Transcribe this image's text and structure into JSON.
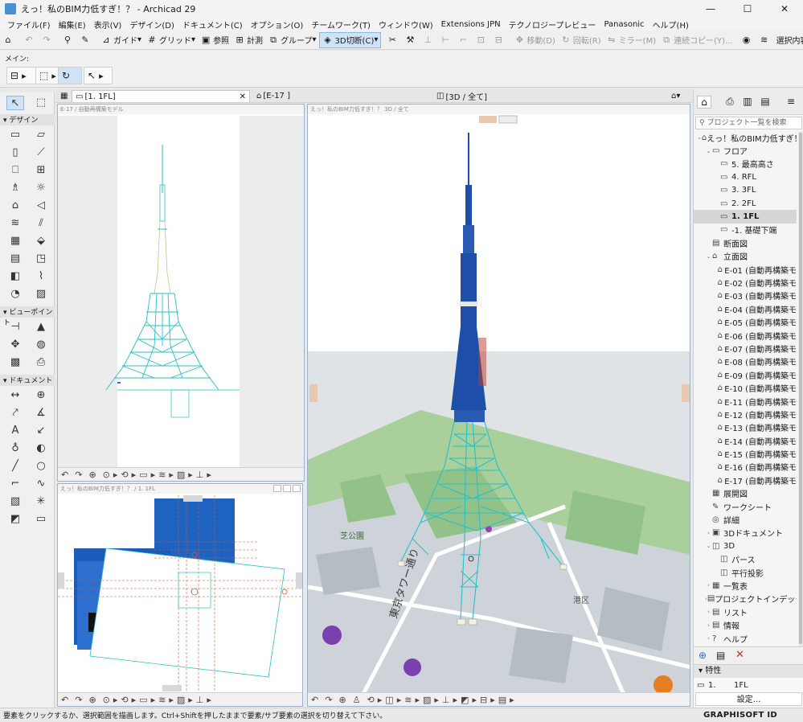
{
  "window": {
    "title": "えっ！私のBIM力低すぎ！？ - Archicad 29",
    "controls": [
      "—",
      "☐",
      "✕"
    ]
  },
  "menu": [
    "ファイル(F)",
    "編集(E)",
    "表示(V)",
    "デザイン(D)",
    "ドキュメント(C)",
    "オプション(O)",
    "チームワーク(T)",
    "ウィンドウ(W)",
    "Extensions JPN",
    "テクノロジープレビュー",
    "Panasonic",
    "ヘルプ(H)"
  ],
  "toolbar": {
    "guide": "ガイド",
    "grid": "グリッド",
    "reference": "参照",
    "measure": "計測",
    "group": "グループ",
    "cut3d": "3D切断(C)",
    "move": "移動(D)",
    "rotate": "回転(R)",
    "mirror": "ミラー(M)",
    "copy": "連続コピー(Y)...",
    "selection": "選択内容のレ"
  },
  "infobox": {
    "label": "メイン:"
  },
  "toolbox": {
    "design": "デザイン",
    "viewpoint": "ビューポイント",
    "document": "ドキュメント"
  },
  "tabs": {
    "floor": "[1. 1FL]",
    "elev": "[E-17 ]",
    "view3d": "[3D / 全て]"
  },
  "panes": {
    "top_title": "E-17 / 自動再構築モデル",
    "bottom_title": "えっ！私のBIM力低すぎ！？ / 1. 1FL",
    "view3d_title": "えっ！私のBIM力低すぎ！？ 3D / 全て"
  },
  "map": {
    "road": "東京タワー通り",
    "park": "芝公園",
    "area": "港区"
  },
  "navigator": {
    "search_placeholder": "プロジェクト一覧を検索",
    "tree": [
      {
        "label": "えっ！私のBIM力低すぎ！",
        "level": 0,
        "icon": "⌂",
        "tw": "⌄"
      },
      {
        "label": "フロア",
        "level": 1,
        "icon": "▭",
        "tw": "⌄"
      },
      {
        "label": "5. 最高高さ",
        "level": 2,
        "icon": "▭",
        "tw": ""
      },
      {
        "label": "4. RFL",
        "level": 2,
        "icon": "▭",
        "tw": ""
      },
      {
        "label": "3. 3FL",
        "level": 2,
        "icon": "▭",
        "tw": ""
      },
      {
        "label": "2. 2FL",
        "level": 2,
        "icon": "▭",
        "tw": ""
      },
      {
        "label": "1. 1FL",
        "level": 2,
        "icon": "▭",
        "tw": "",
        "selected": true
      },
      {
        "label": "-1. 基礎下端",
        "level": 2,
        "icon": "▭",
        "tw": ""
      },
      {
        "label": "断面図",
        "level": 1,
        "icon": "▤",
        "tw": ""
      },
      {
        "label": "立面図",
        "level": 1,
        "icon": "⌂",
        "tw": "⌄"
      },
      {
        "label": "E-01 (自動再構築モ",
        "level": 2,
        "icon": "⌂",
        "tw": ""
      },
      {
        "label": "E-02 (自動再構築モ",
        "level": 2,
        "icon": "⌂",
        "tw": ""
      },
      {
        "label": "E-03 (自動再構築モ",
        "level": 2,
        "icon": "⌂",
        "tw": ""
      },
      {
        "label": "E-04 (自動再構築モ",
        "level": 2,
        "icon": "⌂",
        "tw": ""
      },
      {
        "label": "E-05 (自動再構築モ",
        "level": 2,
        "icon": "⌂",
        "tw": ""
      },
      {
        "label": "E-06 (自動再構築モ",
        "level": 2,
        "icon": "⌂",
        "tw": ""
      },
      {
        "label": "E-07 (自動再構築モ",
        "level": 2,
        "icon": "⌂",
        "tw": ""
      },
      {
        "label": "E-08 (自動再構築モ",
        "level": 2,
        "icon": "⌂",
        "tw": ""
      },
      {
        "label": "E-09 (自動再構築モ",
        "level": 2,
        "icon": "⌂",
        "tw": ""
      },
      {
        "label": "E-10 (自動再構築モ",
        "level": 2,
        "icon": "⌂",
        "tw": ""
      },
      {
        "label": "E-11 (自動再構築モ",
        "level": 2,
        "icon": "⌂",
        "tw": ""
      },
      {
        "label": "E-12 (自動再構築モ",
        "level": 2,
        "icon": "⌂",
        "tw": ""
      },
      {
        "label": "E-13 (自動再構築モ",
        "level": 2,
        "icon": "⌂",
        "tw": ""
      },
      {
        "label": "E-14 (自動再構築モ",
        "level": 2,
        "icon": "⌂",
        "tw": ""
      },
      {
        "label": "E-15 (自動再構築モ",
        "level": 2,
        "icon": "⌂",
        "tw": ""
      },
      {
        "label": "E-16 (自動再構築モ",
        "level": 2,
        "icon": "⌂",
        "tw": ""
      },
      {
        "label": "E-17 (自動再構築モ",
        "level": 2,
        "icon": "⌂",
        "tw": ""
      },
      {
        "label": "展開図",
        "level": 1,
        "icon": "▦",
        "tw": ""
      },
      {
        "label": "ワークシート",
        "level": 1,
        "icon": "✎",
        "tw": ""
      },
      {
        "label": "詳細",
        "level": 1,
        "icon": "◎",
        "tw": ""
      },
      {
        "label": "3Dドキュメント",
        "level": 1,
        "icon": "▣",
        "tw": "›"
      },
      {
        "label": "3D",
        "level": 1,
        "icon": "◫",
        "tw": "⌄"
      },
      {
        "label": "パース",
        "level": 2,
        "icon": "◫",
        "tw": ""
      },
      {
        "label": "平行投影",
        "level": 2,
        "icon": "◫",
        "tw": ""
      },
      {
        "label": "一覧表",
        "level": 1,
        "icon": "▦",
        "tw": "›"
      },
      {
        "label": "プロジェクトインデックス",
        "level": 1,
        "icon": "▤",
        "tw": "›"
      },
      {
        "label": "リスト",
        "level": 1,
        "icon": "▤",
        "tw": "›"
      },
      {
        "label": "情報",
        "level": 1,
        "icon": "▤",
        "tw": "›"
      },
      {
        "label": "ヘルプ",
        "level": 1,
        "icon": "?",
        "tw": "›"
      }
    ]
  },
  "properties": {
    "header": "特性",
    "id": "1.",
    "name": "1FL",
    "settings": "設定..."
  },
  "status": {
    "text": "要素をクリックするか、選択範囲を描画します。Ctrl+Shiftを押したままで要素/サブ要素の選択を切り替えて下さい。",
    "brand": "GRAPHISOFT ID"
  },
  "colors": {
    "accent": "#1e63c0",
    "tower_blue": "#1e4fa8",
    "lattice": "#25c2c9",
    "selection": "#cfe3f6"
  }
}
